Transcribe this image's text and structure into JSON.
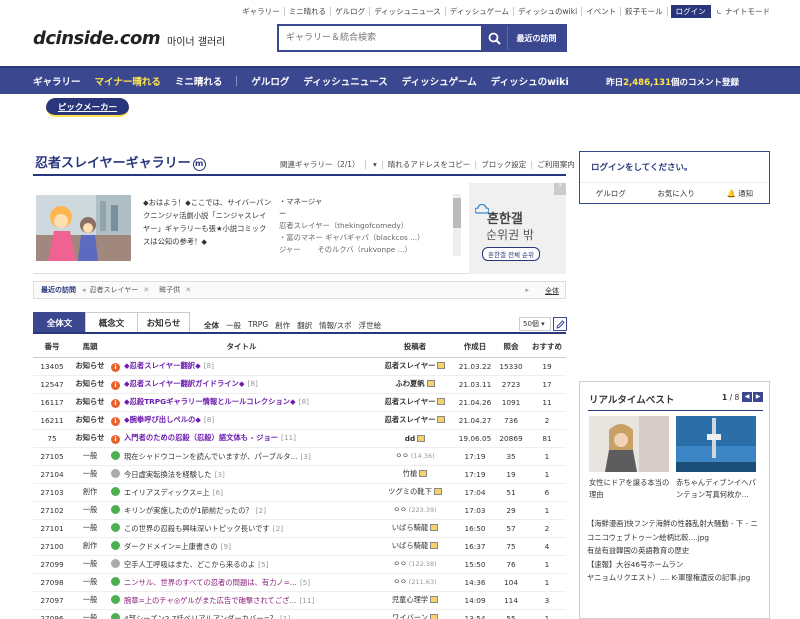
{
  "top_menu": {
    "items": [
      "ギャラリー",
      "ミニ晴れる",
      "ゲルログ",
      "ディッシュニュース",
      "ディッシュゲーム",
      "ディッシュのwiki",
      "イベント",
      "餃子モール"
    ],
    "login": "ログイン",
    "night_mode": "ナイトモード"
  },
  "logo": {
    "text": "dcinside.com",
    "sub": "마이너 갤러리"
  },
  "search": {
    "placeholder": "ギャラリー＆統合検索",
    "recent": "最近の訪問"
  },
  "gnb": {
    "items": [
      "ギャラリー",
      "マイナー晴れる",
      "ミニ晴れる",
      "ゲルログ",
      "ディッシュニュース",
      "ディッシュゲーム",
      "ディッシュのwiki"
    ],
    "active_index": 1,
    "comment_prefix": "昨日",
    "comment_count": "2,486,131",
    "comment_suffix": "個のコメント登録"
  },
  "pick_maker": "ピックメーカー",
  "gallery": {
    "title": "忍者スレイヤーギャラリー",
    "mark": "m",
    "menu": [
      "関連ギャラリー（2/1）",
      "晴れるアドレスをコピー",
      "ブロック設定",
      "ご利用案内"
    ],
    "intro_text": "◆おはよう！◆ここでは、サイバーパンクニンジャ活劇小説「ニンジャスレイヤー」ギャラリーも張★小説コミックスは公知の参考！◆",
    "manager_lines": [
      "・マネージャ",
      "ー",
      "忍者スレイヤー（thekingofcomedy）",
      "・富のマネー ギャバギャバ（blackcos ...）",
      "ジャー　　 そのルクバ（rukvonpe ...）"
    ]
  },
  "ad": {
    "title": "혼한갤",
    "subtitle": "순위권 밖",
    "button": "혼한갤 전체 순위",
    "corner": "?"
  },
  "recent_visits": {
    "label": "最近の訪問",
    "items": [
      "忍者スレイヤー",
      "眸子供"
    ],
    "all": "全体"
  },
  "tabs": [
    "全体文",
    "概念文",
    "お知らせ"
  ],
  "heads": [
    "全体",
    "一般",
    "TRPG",
    "創作",
    "翻訳",
    "情報/スポ",
    "浮世絵"
  ],
  "list_size": "50個 ▾",
  "table": {
    "headers": [
      "番号",
      "馬頭",
      "タイトル",
      "投稿者",
      "作成日",
      "照会",
      "おすすめ"
    ],
    "rows": [
      {
        "num": "13405",
        "head": "お知らせ",
        "icon": "n",
        "title": "◆忍者スレイヤー翻訳◆",
        "comments": "[8]",
        "writer": "忍者スレイヤー",
        "ip": "",
        "date": "21.03.22",
        "views": "15330",
        "rec": "19",
        "cls": "notice"
      },
      {
        "num": "12547",
        "head": "お知らせ",
        "icon": "n",
        "title": "◆忍者スレイヤー翻訳ガイドライン◆",
        "comments": "[8]",
        "writer": "ふわ夏帆",
        "ip": "",
        "date": "21.03.11",
        "views": "2723",
        "rec": "17",
        "cls": "notice"
      },
      {
        "num": "16117",
        "head": "お知らせ",
        "icon": "n",
        "title": "◆忍殺TRPGギャラリー情報とルールコレクション◆",
        "comments": "[8]",
        "writer": "忍者スレイヤー",
        "ip": "",
        "date": "21.04.26",
        "views": "1091",
        "rec": "11",
        "cls": "notice"
      },
      {
        "num": "16211",
        "head": "お知らせ",
        "icon": "n",
        "title": "◆腕拳呼び出しペルの◆",
        "comments": "[8]",
        "writer": "忍者スレイヤー",
        "ip": "",
        "date": "21.04.27",
        "views": "736",
        "rec": "2",
        "cls": "notice"
      },
      {
        "num": "75",
        "head": "お知らせ",
        "icon": "n",
        "title": "入門者のための忍殺（忍殺）語文体も - ジョー",
        "comments": "[11]",
        "writer": "dd",
        "ip": "",
        "date": "19.06.05",
        "views": "20869",
        "rec": "81",
        "cls": "notice"
      },
      {
        "num": "27105",
        "head": "一般",
        "icon": "g",
        "title": "現在シャドウコーンを読んでいますが、パーブルタ...",
        "comments": "[3]",
        "writer": "ㅇㅇ",
        "ip": "(14.36)",
        "date": "17:19",
        "views": "35",
        "rec": "1",
        "cls": ""
      },
      {
        "num": "27104",
        "head": "一般",
        "icon": "gr",
        "title": "今日虚実転換法を経験した",
        "comments": "[3]",
        "writer": "竹槍",
        "ip": "",
        "date": "17:19",
        "views": "19",
        "rec": "1",
        "cls": ""
      },
      {
        "num": "27103",
        "head": "創作",
        "icon": "g",
        "title": "エイリアスディックス=上",
        "comments": "[6]",
        "writer": "ツグミの靴下",
        "ip": "",
        "date": "17:04",
        "views": "51",
        "rec": "6",
        "cls": ""
      },
      {
        "num": "27102",
        "head": "一般",
        "icon": "g",
        "title": "キリンが実施したのが1節前だったの？",
        "comments": "[2]",
        "writer": "ㅇㅇ",
        "ip": "(223.39)",
        "date": "17:03",
        "views": "29",
        "rec": "1",
        "cls": ""
      },
      {
        "num": "27101",
        "head": "一般",
        "icon": "g",
        "title": "この世界の忍殺も興味深いトピック長いです",
        "comments": "[2]",
        "writer": "いばら騎龍",
        "ip": "",
        "date": "16:50",
        "views": "57",
        "rec": "2",
        "cls": ""
      },
      {
        "num": "27100",
        "head": "創作",
        "icon": "g",
        "title": "ダークドメイン=上康書きの",
        "comments": "[9]",
        "writer": "いばら騎龍",
        "ip": "",
        "date": "16:37",
        "views": "75",
        "rec": "4",
        "cls": ""
      },
      {
        "num": "27099",
        "head": "一般",
        "icon": "gr",
        "title": "空手人工呼吸はまた、どこから来るのよ",
        "comments": "[5]",
        "writer": "ㅇㅇ",
        "ip": "(122.38)",
        "date": "15:50",
        "views": "76",
        "rec": "1",
        "cls": ""
      },
      {
        "num": "27098",
        "head": "一般",
        "icon": "g",
        "title": "ニンサル、世界のすべての忍者の問題は、有力ノ=...",
        "comments": "[5]",
        "writer": "ㅇㅇ",
        "ip": "(211.63)",
        "date": "14:36",
        "views": "104",
        "rec": "1",
        "cls": "pink"
      },
      {
        "num": "27097",
        "head": "一般",
        "icon": "g",
        "title": "腕章=上のチャ◎ゲルがまた広告で砲撃されてござ...",
        "comments": "[11]",
        "writer": "児童心理学",
        "ip": "",
        "date": "14:09",
        "views": "114",
        "rec": "3",
        "cls": "pink"
      },
      {
        "num": "27096",
        "head": "一般",
        "icon": "g",
        "title": "4部シーズン2 7話ベリアルアンダーカバー=？",
        "comments": "[1]",
        "writer": "ワイバーン",
        "ip": "",
        "date": "13:54",
        "views": "55",
        "rec": "1",
        "cls": ""
      }
    ]
  },
  "login_box": {
    "title": "ログインをしてください。",
    "links": [
      "ゲルログ",
      "お気に入り",
      "通知"
    ]
  },
  "realtime": {
    "title": "リアルタイムベスト",
    "page": "1",
    "total": "/ 8",
    "captions": [
      {
        "text": "女性にドアを譲る本当の理由",
        "badge": ""
      },
      {
        "text": "赤ちゃんディブンイヘパンテョン写真何枚か...",
        "badge": ""
      }
    ],
    "news": [
      "【海鮮漫画]快フンテ海鮮の性器乱射大騒動 - 下 - ニコニコウェブトゥーン絵柄比較....jpg",
      "有益有益韓国の英語教育の歴史",
      "【速報】大谷46号ホームラン",
      "ヤニョムリクエスト）.... K-軍服権遺反の記事.jpg"
    ]
  }
}
